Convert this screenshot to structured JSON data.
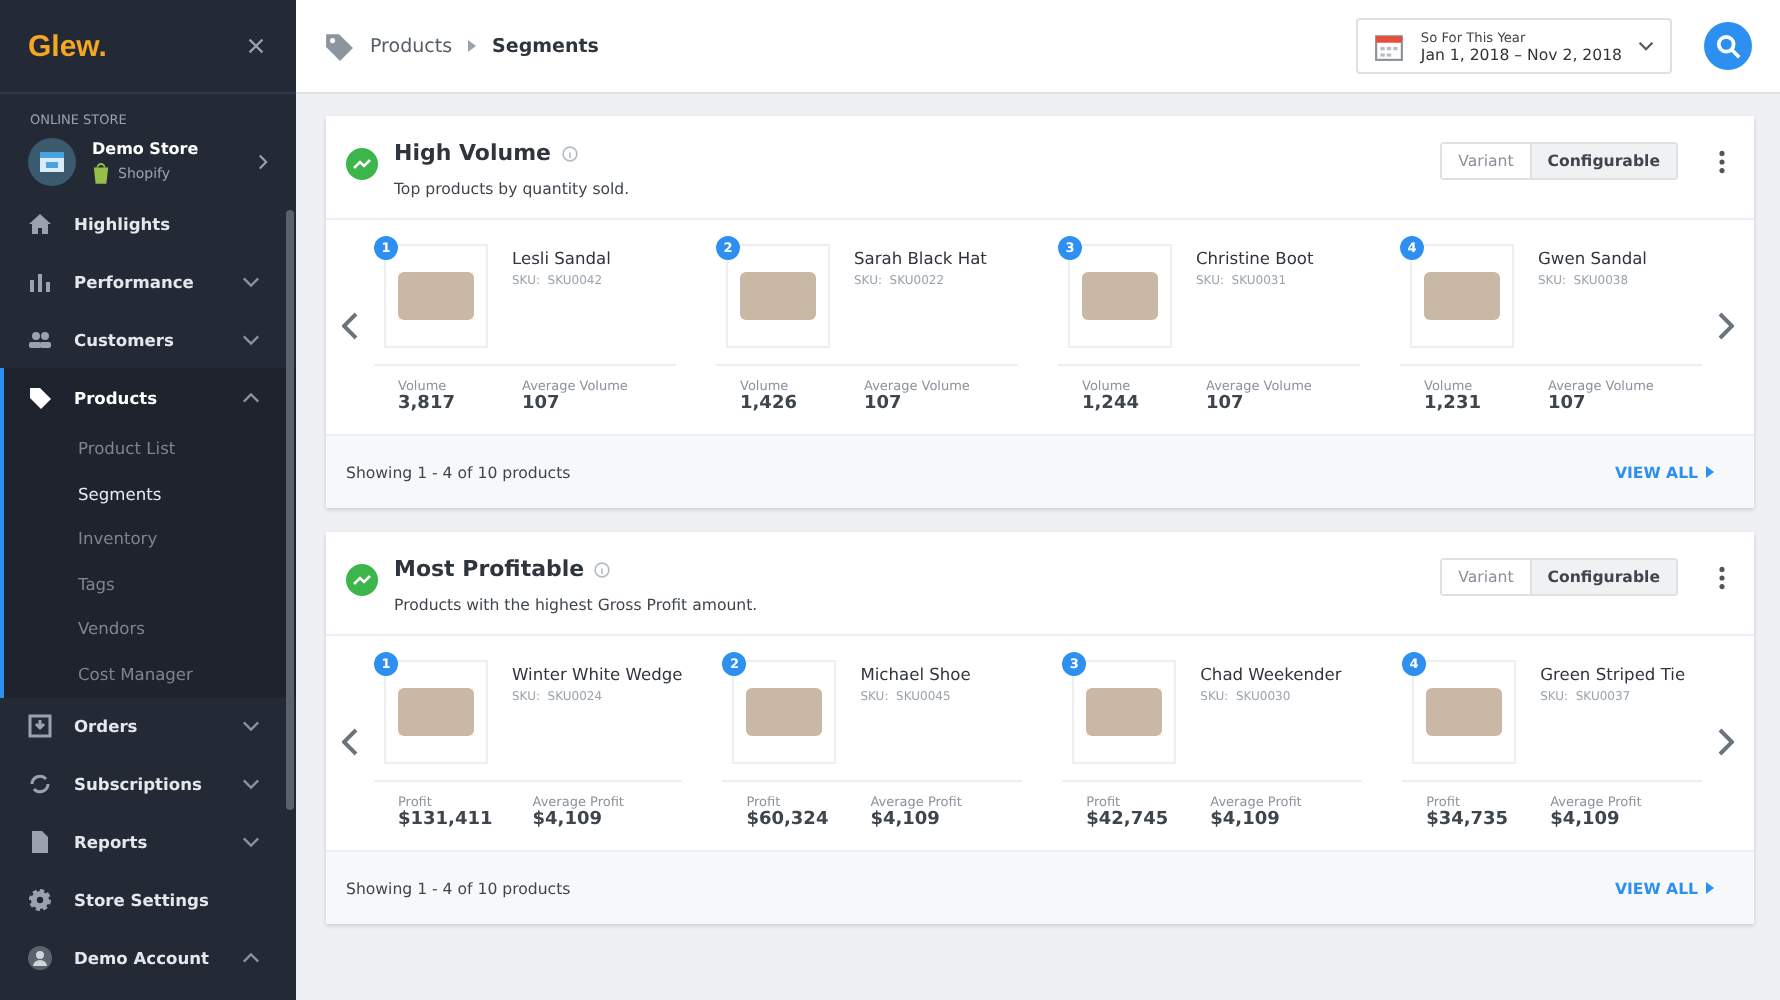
{
  "sidebar": {
    "logo": "Glew.",
    "section_label": "ONLINE STORE",
    "store": {
      "name": "Demo Store",
      "platform": "Shopify"
    },
    "items": [
      {
        "label": "Highlights",
        "selected": false
      },
      {
        "label": "Performance",
        "selected": false,
        "expanded": false
      },
      {
        "label": "Customers",
        "selected": false,
        "expanded": false
      },
      {
        "label": "Products",
        "selected": true,
        "expanded": true,
        "children": [
          {
            "label": "Product List",
            "selected": false
          },
          {
            "label": "Segments",
            "selected": true
          },
          {
            "label": "Inventory",
            "selected": false
          },
          {
            "label": "Tags",
            "selected": false
          },
          {
            "label": "Vendors",
            "selected": false
          },
          {
            "label": "Cost Manager",
            "selected": false
          }
        ]
      },
      {
        "label": "Orders",
        "selected": false,
        "expanded": false
      },
      {
        "label": "Subscriptions",
        "selected": false,
        "expanded": false
      },
      {
        "label": "Reports",
        "selected": false,
        "expanded": false
      },
      {
        "label": "Store Settings",
        "selected": false
      },
      {
        "label": "Demo Account",
        "selected": false,
        "expanded": true
      }
    ]
  },
  "breadcrumb": [
    "Products",
    "Segments"
  ],
  "date_range": {
    "label": "So For This Year",
    "range": "Jan 1, 2018 – Nov 2, 2018"
  },
  "segments": [
    {
      "title": "High Volume",
      "description": "Top products by quantity sold.",
      "toggle": [
        {
          "label": "Variant",
          "selected": false
        },
        {
          "label": "Configurable",
          "selected": true
        }
      ],
      "products": [
        {
          "rank": "1",
          "name": "Lesli Sandal",
          "sku": "SKU:  SKU0042",
          "stat1_label": "Volume",
          "stat1": "3,817",
          "stat2_label": "Average Volume",
          "stat2": "107"
        },
        {
          "rank": "2",
          "name": "Sarah Black Hat",
          "sku": "SKU:  SKU0022",
          "stat1_label": "Volume",
          "stat1": "1,426",
          "stat2_label": "Average Volume",
          "stat2": "107"
        },
        {
          "rank": "3",
          "name": "Christine Boot",
          "sku": "SKU:  SKU0031",
          "stat1_label": "Volume",
          "stat1": "1,244",
          "stat2_label": "Average Volume",
          "stat2": "107"
        },
        {
          "rank": "4",
          "name": "Gwen Sandal",
          "sku": "SKU:  SKU0038",
          "stat1_label": "Volume",
          "stat1": "1,231",
          "stat2_label": "Average Volume",
          "stat2": "107"
        }
      ],
      "showing": "Showing 1 - 4 of 10 products",
      "view_all": "VIEW ALL"
    },
    {
      "title": "Most Profitable",
      "description": "Products with the highest Gross Profit amount.",
      "toggle": [
        {
          "label": "Variant",
          "selected": false
        },
        {
          "label": "Configurable",
          "selected": true
        }
      ],
      "products": [
        {
          "rank": "1",
          "name": "Winter White Wedge",
          "sku": "SKU:  SKU0024",
          "stat1_label": "Profit",
          "stat1": "$131,411",
          "stat2_label": "Average Profit",
          "stat2": "$4,109"
        },
        {
          "rank": "2",
          "name": "Michael Shoe",
          "sku": "SKU:  SKU0045",
          "stat1_label": "Profit",
          "stat1": "$60,324",
          "stat2_label": "Average Profit",
          "stat2": "$4,109"
        },
        {
          "rank": "3",
          "name": "Chad Weekender",
          "sku": "SKU:  SKU0030",
          "stat1_label": "Profit",
          "stat1": "$42,745",
          "stat2_label": "Average Profit",
          "stat2": "$4,109"
        },
        {
          "rank": "4",
          "name": "Green Striped Tie",
          "sku": "SKU:  SKU0037",
          "stat1_label": "Profit",
          "stat1": "$34,735",
          "stat2_label": "Average Profit",
          "stat2": "$4,109"
        }
      ],
      "showing": "Showing 1 - 4 of 10 products",
      "view_all": "VIEW ALL"
    }
  ]
}
